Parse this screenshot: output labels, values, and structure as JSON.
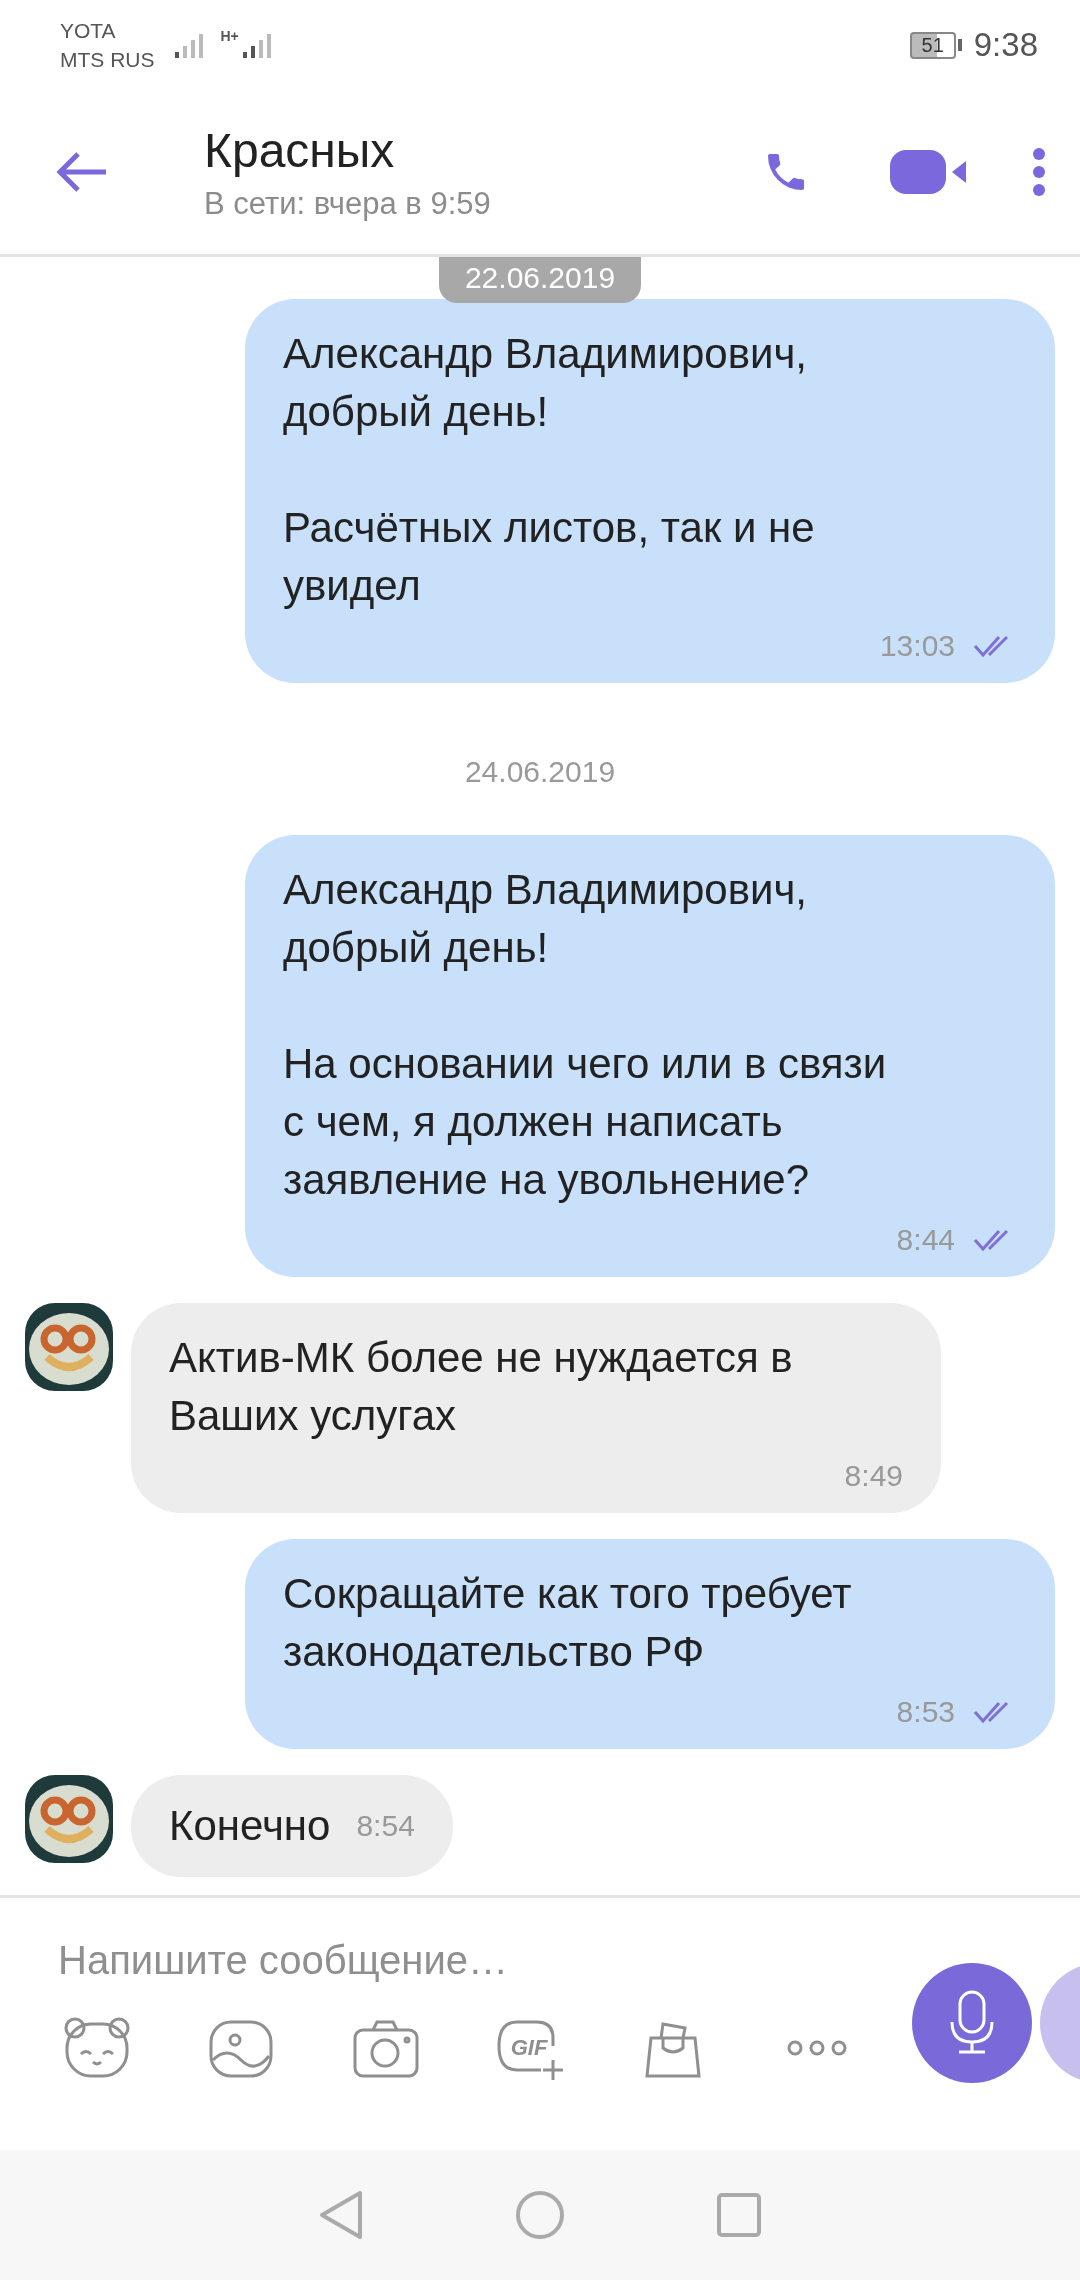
{
  "status_bar": {
    "carriers": [
      "YOTA",
      "MTS RUS"
    ],
    "network_type": "H+",
    "battery": "51",
    "time": "9:38"
  },
  "header": {
    "title": "Красных",
    "subtitle": "В сети: вчера в 9:59"
  },
  "messages": [
    {
      "kind": "date",
      "text": "22.06.2019",
      "floating": true
    },
    {
      "kind": "outgoing",
      "text": "Александр Владимирович,\nдобрый день!\n\nРасчётных листов, так и не\nувидел",
      "time": "13:03",
      "read": true
    },
    {
      "kind": "date",
      "text": "24.06.2019",
      "floating": false
    },
    {
      "kind": "outgoing",
      "text": "Александр Владимирович,\nдобрый день!\n\nНа основании чего или в связи\nс чем, я должен написать\nзаявление на увольнение?",
      "time": "8:44",
      "read": true
    },
    {
      "kind": "incoming",
      "text": "Актив-МК более не нуждается в\nВаших услугах",
      "time": "8:49"
    },
    {
      "kind": "outgoing",
      "text": "Сокращайте как того требует\nзаконодательство РФ",
      "time": "8:53",
      "read": true
    },
    {
      "kind": "incoming",
      "text": "Конечно",
      "time": "8:54",
      "inline_time": true
    }
  ],
  "composer": {
    "placeholder": "Напишите сообщение…",
    "gif_label": "GIF"
  }
}
